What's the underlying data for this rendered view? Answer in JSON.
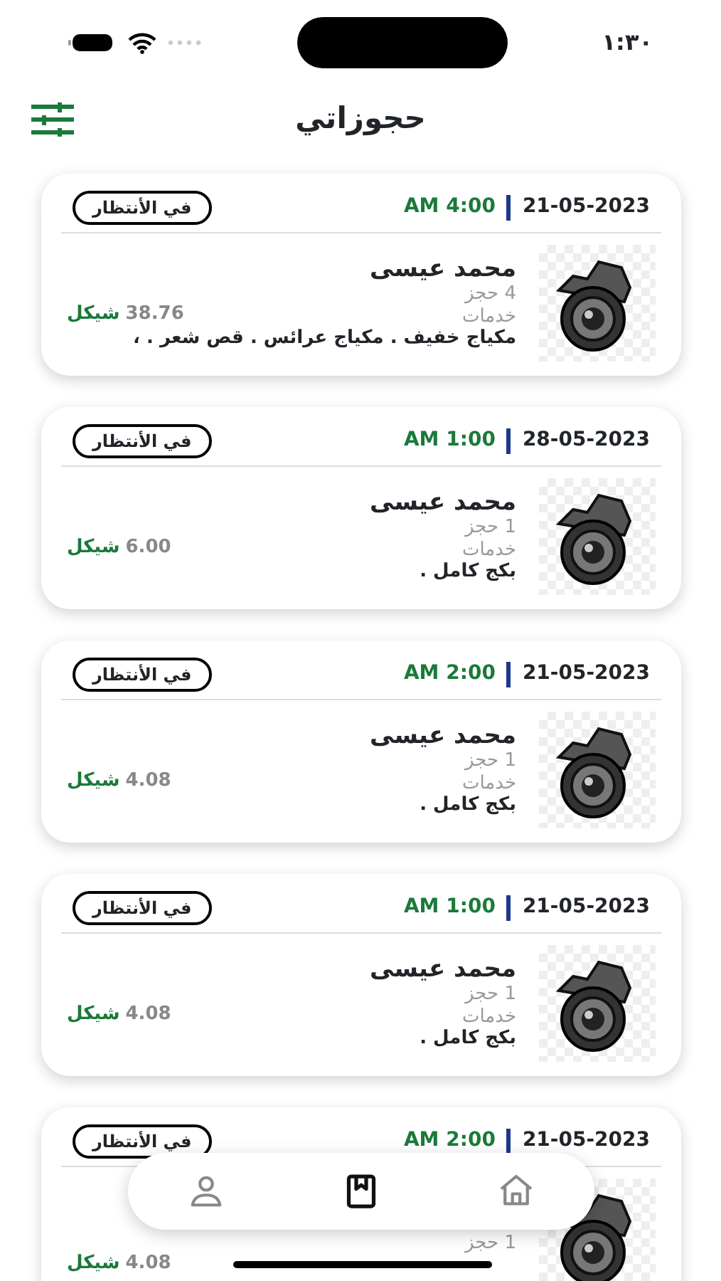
{
  "status_bar": {
    "time": "١:٣٠"
  },
  "header": {
    "title": "حجوزاتي"
  },
  "bookings": [
    {
      "date": "21-05-2023",
      "time": "AM 4:00",
      "status": "في الأنتظار",
      "name": "محمد عيسى",
      "count": "4 حجز",
      "services_label": "خدمات",
      "services": "مكياج خفيف . مكياج عرائس . قص شعر . ،",
      "amount": "38.76",
      "currency": "شيكل"
    },
    {
      "date": "28-05-2023",
      "time": "AM 1:00",
      "status": "في الأنتظار",
      "name": "محمد عيسى",
      "count": "1 حجز",
      "services_label": "خدمات",
      "services": "بكج كامل .",
      "amount": "6.00",
      "currency": "شيكل"
    },
    {
      "date": "21-05-2023",
      "time": "AM 2:00",
      "status": "في الأنتظار",
      "name": "محمد عيسى",
      "count": "1 حجز",
      "services_label": "خدمات",
      "services": "بكج كامل .",
      "amount": "4.08",
      "currency": "شيكل"
    },
    {
      "date": "21-05-2023",
      "time": "AM 1:00",
      "status": "في الأنتظار",
      "name": "محمد عيسى",
      "count": "1 حجز",
      "services_label": "خدمات",
      "services": "بكج كامل .",
      "amount": "4.08",
      "currency": "شيكل"
    },
    {
      "date": "21-05-2023",
      "time": "AM 2:00",
      "status": "في الأنتظار",
      "count": "1 حجز",
      "amount": "4.08",
      "currency": "شيكل"
    }
  ],
  "bottom_nav": [
    {
      "kind": "home",
      "selected": false
    },
    {
      "kind": "bookings",
      "selected": true
    },
    {
      "kind": "profile",
      "selected": false
    }
  ]
}
